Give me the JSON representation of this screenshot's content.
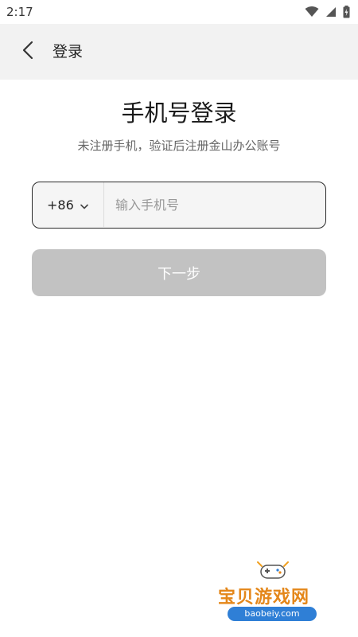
{
  "status_bar": {
    "time": "2:17",
    "icons": [
      "wifi-icon",
      "signal-icon",
      "battery-icon"
    ]
  },
  "nav": {
    "back_icon": "chevron-left-icon",
    "title": "登录"
  },
  "main": {
    "title": "手机号登录",
    "subtitle": "未注册手机，验证后注册金山办公账号",
    "country_code": "+86",
    "phone_placeholder": "输入手机号",
    "phone_value": "",
    "next_button": "下一步"
  },
  "watermark": {
    "title": "宝贝游戏网",
    "url": "baobeiy.com"
  },
  "colors": {
    "nav_bg": "#f2f2f2",
    "button_disabled": "#c2c2c2",
    "input_border": "#2a2a2a"
  }
}
